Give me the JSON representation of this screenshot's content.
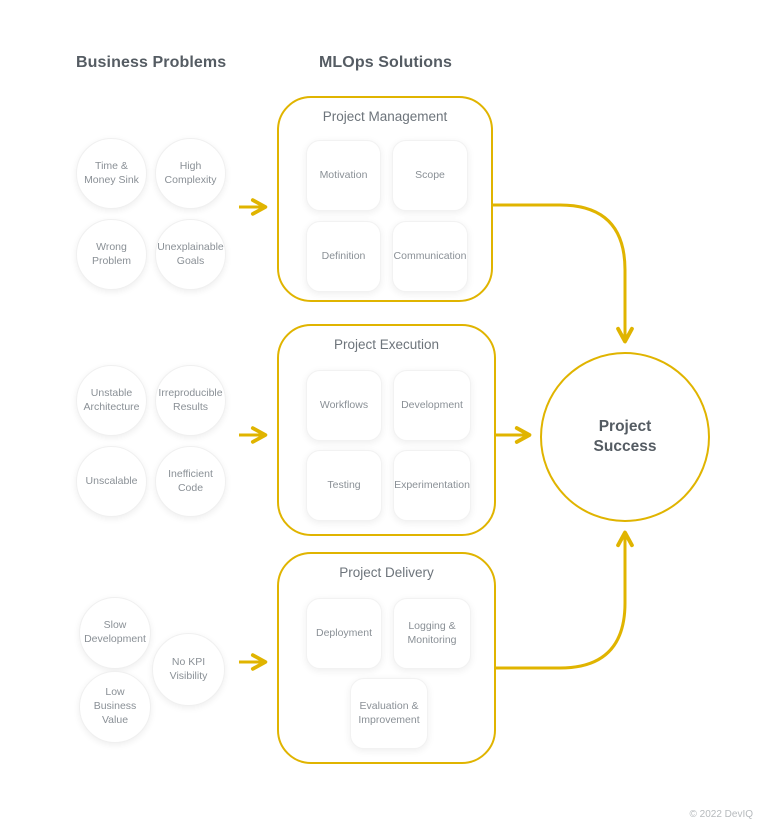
{
  "headings": {
    "problems": "Business Problems",
    "solutions": "MLOps Solutions"
  },
  "colors": {
    "accent": "#e0b400",
    "heading_text": "#555c63",
    "body_text": "#8a9096",
    "group_title_text": "#6d747b",
    "background": "#ffffff",
    "footer_text": "#b6babd"
  },
  "problem_groups": [
    {
      "name": "project-management-problems",
      "circles": [
        {
          "label": "Time & Money Sink",
          "lines": [
            "Time &",
            "Money Sink"
          ]
        },
        {
          "label": "High Complexity",
          "lines": [
            "High",
            "Complexity"
          ]
        },
        {
          "label": "Wrong Problem",
          "lines": [
            "Wrong",
            "Problem"
          ]
        },
        {
          "label": "Unexplainable Goals",
          "lines": [
            "Unexplainable",
            "Goals"
          ]
        }
      ]
    },
    {
      "name": "project-execution-problems",
      "circles": [
        {
          "label": "Unstable Architecture",
          "lines": [
            "Unstable",
            "Architecture"
          ]
        },
        {
          "label": "Irreproducible Results",
          "lines": [
            "Irreproducible",
            "Results"
          ]
        },
        {
          "label": "Unscalable",
          "lines": [
            "Unscalable"
          ]
        },
        {
          "label": "Inefficient Code",
          "lines": [
            "Inefficient Code"
          ]
        }
      ]
    },
    {
      "name": "project-delivery-problems",
      "circles": [
        {
          "label": "Slow Development",
          "lines": [
            "Slow",
            "Development"
          ]
        },
        {
          "label": "Low Business Value",
          "lines": [
            "Low Business",
            "Value"
          ]
        },
        {
          "label": "No KPI Visibility",
          "lines": [
            "No KPI Visibility"
          ]
        }
      ]
    }
  ],
  "solution_groups": [
    {
      "name": "project-management",
      "title": "Project Management",
      "tiles": [
        {
          "label": "Motivation",
          "lines": [
            "Motivation"
          ]
        },
        {
          "label": "Scope",
          "lines": [
            "Scope"
          ]
        },
        {
          "label": "Definition",
          "lines": [
            "Definition"
          ]
        },
        {
          "label": "Communication",
          "lines": [
            "Communication"
          ]
        }
      ]
    },
    {
      "name": "project-execution",
      "title": "Project Execution",
      "tiles": [
        {
          "label": "Workflows",
          "lines": [
            "Workflows"
          ]
        },
        {
          "label": "Development",
          "lines": [
            "Development"
          ]
        },
        {
          "label": "Testing",
          "lines": [
            "Testing"
          ]
        },
        {
          "label": "Experimentation",
          "lines": [
            "Experimentation"
          ]
        }
      ]
    },
    {
      "name": "project-delivery",
      "title": "Project Delivery",
      "tiles": [
        {
          "label": "Deployment",
          "lines": [
            "Deployment"
          ]
        },
        {
          "label": "Logging & Monitoring",
          "lines": [
            "Logging &",
            "Monitoring"
          ]
        },
        {
          "label": "Evaluation & Improvement",
          "lines": [
            "Evaluation &",
            "Improvement"
          ]
        }
      ]
    }
  ],
  "outcome": {
    "label": "Project Success",
    "lines": [
      "Project",
      "Success"
    ]
  },
  "footer": {
    "copyright": "© 2022 DevIQ"
  }
}
